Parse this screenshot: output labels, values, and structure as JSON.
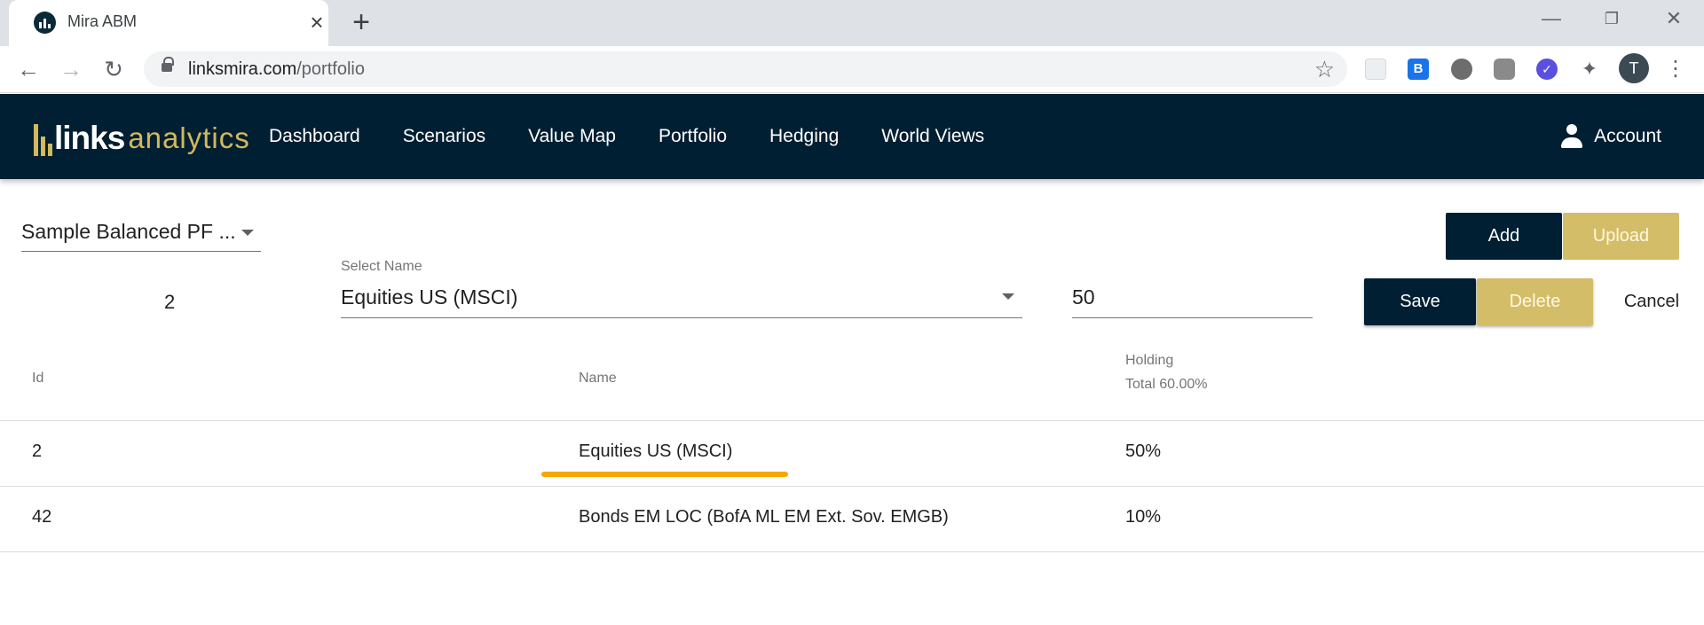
{
  "browser": {
    "tab_title": "Mira ABM",
    "url_host": "linksmira.com",
    "url_path": "/portfolio",
    "profile_initial": "T"
  },
  "header": {
    "logo_links": "links",
    "logo_analytics": "analytics",
    "nav": [
      "Dashboard",
      "Scenarios",
      "Value Map",
      "Portfolio",
      "Hedging",
      "World Views"
    ],
    "account_label": "Account"
  },
  "controls": {
    "portfolio_select": "Sample Balanced PF ...",
    "add_label": "Add",
    "upload_label": "Upload",
    "edit_id": "2",
    "select_name_label": "Select Name",
    "select_name_value": "Equities US (MSCI)",
    "holding_value": "50",
    "save_label": "Save",
    "delete_label": "Delete",
    "cancel_label": "Cancel"
  },
  "table": {
    "headers": {
      "id": "Id",
      "name": "Name",
      "holding": "Holding",
      "total": "Total 60.00%"
    },
    "rows": [
      {
        "id": "2",
        "name": "Equities US (MSCI)",
        "holding": "50%"
      },
      {
        "id": "42",
        "name": "Bonds EM LOC (BofA ML EM Ext. Sov. EMGB)",
        "holding": "10%"
      }
    ]
  },
  "colors": {
    "navy": "#001f33",
    "gold": "#d4bd68",
    "highlight": "#f5a800"
  }
}
